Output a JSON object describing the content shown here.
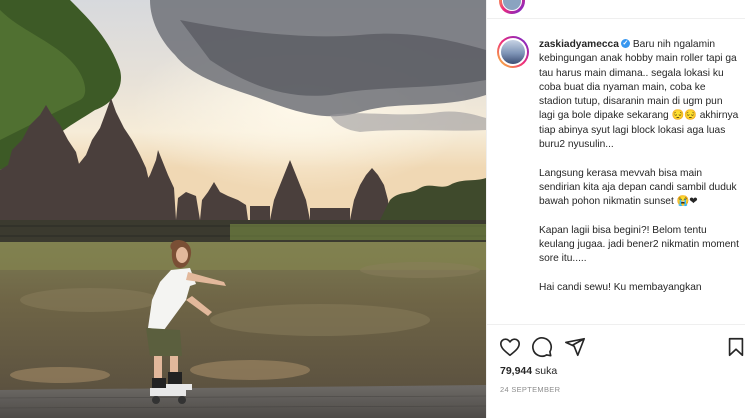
{
  "post": {
    "username": "zaskiadyamecca",
    "paragraphs": [
      "Baru nih ngalamin kebingungan anak hobby main roller tapi ga tau harus main dimana.. segala lokasi ku coba buat dia nyaman main, coba ke stadion tutup, disaranin main di ugm pun lagi ga bole dipake sekarang 😔😔 akhirnya tiap abinya syut lagi block lokasi aga luas buru2 nyusulin...",
      "Langsung kerasa mevvah bisa main sendirian kita aja depan candi sambil duduk bawah pohon nikmatin sunset 😭❤",
      "Kapan lagii bisa begini?! Belom tentu keulang jugaa. jadi bener2 nikmatin moment sore itu.....",
      "Hai candi sewu! Ku membayangkan"
    ],
    "likes_count": "79,944",
    "likes_label": "suka",
    "date": "24 SEPTEMBER"
  },
  "icons": {
    "like": "heart-icon",
    "comment": "comment-icon",
    "share": "share-icon",
    "save": "bookmark-icon",
    "verified": "verified-badge-icon"
  },
  "colors": {
    "verified": "#3897f0",
    "text": "#262626",
    "muted": "#8e8e8e"
  }
}
